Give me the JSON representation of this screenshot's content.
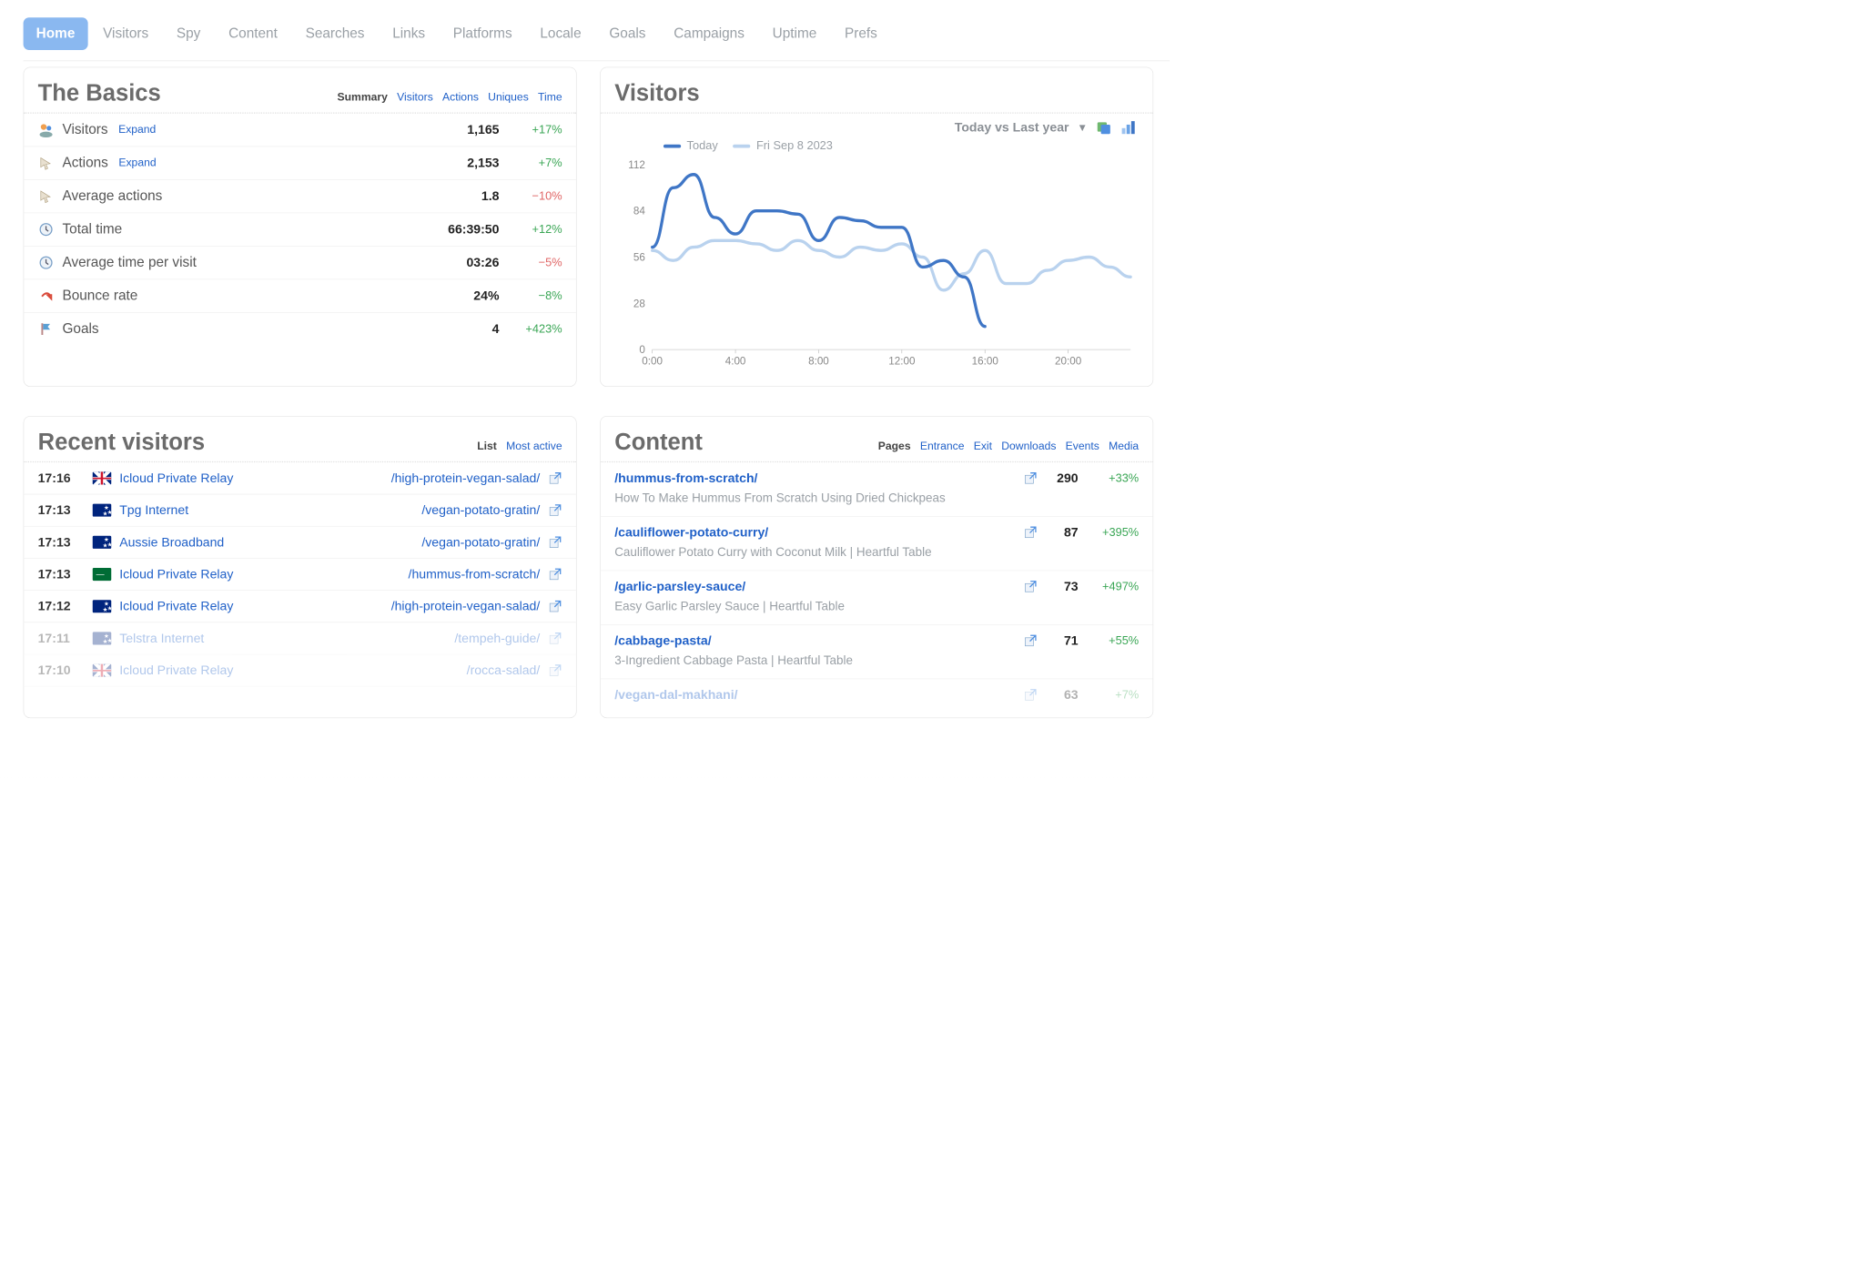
{
  "nav": {
    "items": [
      "Home",
      "Visitors",
      "Spy",
      "Content",
      "Searches",
      "Links",
      "Platforms",
      "Locale",
      "Goals",
      "Campaigns",
      "Uptime",
      "Prefs"
    ],
    "active": 0
  },
  "basics": {
    "title": "The Basics",
    "tabs": [
      "Summary",
      "Visitors",
      "Actions",
      "Uniques",
      "Time"
    ],
    "activeTab": 0,
    "rows": [
      {
        "icon": "people-icon",
        "label": "Visitors",
        "expand": "Expand",
        "value": "1,165",
        "delta": "+17%",
        "deltaClass": "pos"
      },
      {
        "icon": "cursor-icon",
        "label": "Actions",
        "expand": "Expand",
        "value": "2,153",
        "delta": "+7%",
        "deltaClass": "pos"
      },
      {
        "icon": "cursor-icon",
        "label": "Average actions",
        "value": "1.8",
        "delta": "−10%",
        "deltaClass": "neg"
      },
      {
        "icon": "clock-icon",
        "label": "Total time",
        "value": "66:39:50",
        "delta": "+12%",
        "deltaClass": "pos"
      },
      {
        "icon": "clock-icon",
        "label": "Average time per visit",
        "value": "03:26",
        "delta": "−5%",
        "deltaClass": "neg"
      },
      {
        "icon": "bounce-icon",
        "label": "Bounce rate",
        "value": "24%",
        "delta": "−8%",
        "deltaClass": "pos"
      },
      {
        "icon": "flag-icon",
        "label": "Goals",
        "value": "4",
        "delta": "+423%",
        "deltaClass": "pos"
      }
    ]
  },
  "visitorsChart": {
    "title": "Visitors",
    "compareLabel": "Today vs Last year",
    "legend": [
      {
        "name": "Today",
        "color": "#3f76c6"
      },
      {
        "name": "Fri Sep 8 2023",
        "color": "#b9d2ee"
      }
    ]
  },
  "chart_data": {
    "type": "line",
    "x_ticks": [
      "0:00",
      "4:00",
      "8:00",
      "12:00",
      "16:00",
      "20:00"
    ],
    "y_ticks": [
      0,
      28,
      56,
      84,
      112
    ],
    "ylim": [
      0,
      112
    ],
    "xlim_hours": [
      0,
      23
    ],
    "series": [
      {
        "name": "Today",
        "color": "#3f76c6",
        "x": [
          0,
          1,
          2,
          3,
          4,
          5,
          6,
          7,
          8,
          9,
          10,
          11,
          12,
          13,
          14,
          15,
          16
        ],
        "y": [
          62,
          98,
          106,
          80,
          70,
          84,
          84,
          82,
          66,
          80,
          78,
          74,
          74,
          50,
          54,
          44,
          14
        ]
      },
      {
        "name": "Fri Sep 8 2023",
        "color": "#b9d2ee",
        "x": [
          0,
          1,
          2,
          3,
          4,
          5,
          6,
          7,
          8,
          9,
          10,
          11,
          12,
          13,
          14,
          15,
          16,
          17,
          18,
          19,
          20,
          21,
          22,
          23
        ],
        "y": [
          60,
          54,
          62,
          66,
          66,
          64,
          60,
          66,
          60,
          56,
          62,
          60,
          64,
          56,
          36,
          46,
          60,
          40,
          40,
          48,
          54,
          56,
          50,
          44
        ]
      }
    ]
  },
  "recent": {
    "title": "Recent visitors",
    "tabs": [
      "List",
      "Most active"
    ],
    "activeTab": 0,
    "rows": [
      {
        "time": "17:16",
        "flag": "gb",
        "isp": "Icloud Private Relay",
        "path": "/high-protein-vegan-salad/"
      },
      {
        "time": "17:13",
        "flag": "au",
        "isp": "Tpg Internet",
        "path": "/vegan-potato-gratin/"
      },
      {
        "time": "17:13",
        "flag": "au",
        "isp": "Aussie Broadband",
        "path": "/vegan-potato-gratin/"
      },
      {
        "time": "17:13",
        "flag": "sa",
        "isp": "Icloud Private Relay",
        "path": "/hummus-from-scratch/"
      },
      {
        "time": "17:12",
        "flag": "au",
        "isp": "Icloud Private Relay",
        "path": "/high-protein-vegan-salad/"
      },
      {
        "time": "17:11",
        "flag": "au",
        "isp": "Telstra Internet",
        "path": "/tempeh-guide/",
        "faded": true
      },
      {
        "time": "17:10",
        "flag": "gb",
        "isp": "Icloud Private Relay",
        "path": "/rocca-salad/",
        "faded": true
      }
    ]
  },
  "content": {
    "title": "Content",
    "tabs": [
      "Pages",
      "Entrance",
      "Exit",
      "Downloads",
      "Events",
      "Media"
    ],
    "activeTab": 0,
    "rows": [
      {
        "path": "/hummus-from-scratch/",
        "page": "How To Make Hummus From Scratch Using Dried Chickpeas",
        "count": "290",
        "delta": "+33%",
        "deltaClass": "pos"
      },
      {
        "path": "/cauliflower-potato-curry/",
        "page": "Cauliflower Potato Curry with Coconut Milk | Heartful Table",
        "count": "87",
        "delta": "+395%",
        "deltaClass": "pos"
      },
      {
        "path": "/garlic-parsley-sauce/",
        "page": "Easy Garlic Parsley Sauce | Heartful Table",
        "count": "73",
        "delta": "+497%",
        "deltaClass": "pos"
      },
      {
        "path": "/cabbage-pasta/",
        "page": "3-Ingredient Cabbage Pasta | Heartful Table",
        "count": "71",
        "delta": "+55%",
        "deltaClass": "pos"
      },
      {
        "path": "/vegan-dal-makhani/",
        "page": "",
        "count": "63",
        "delta": "+7%",
        "deltaClass": "pos",
        "faded": true
      }
    ]
  }
}
